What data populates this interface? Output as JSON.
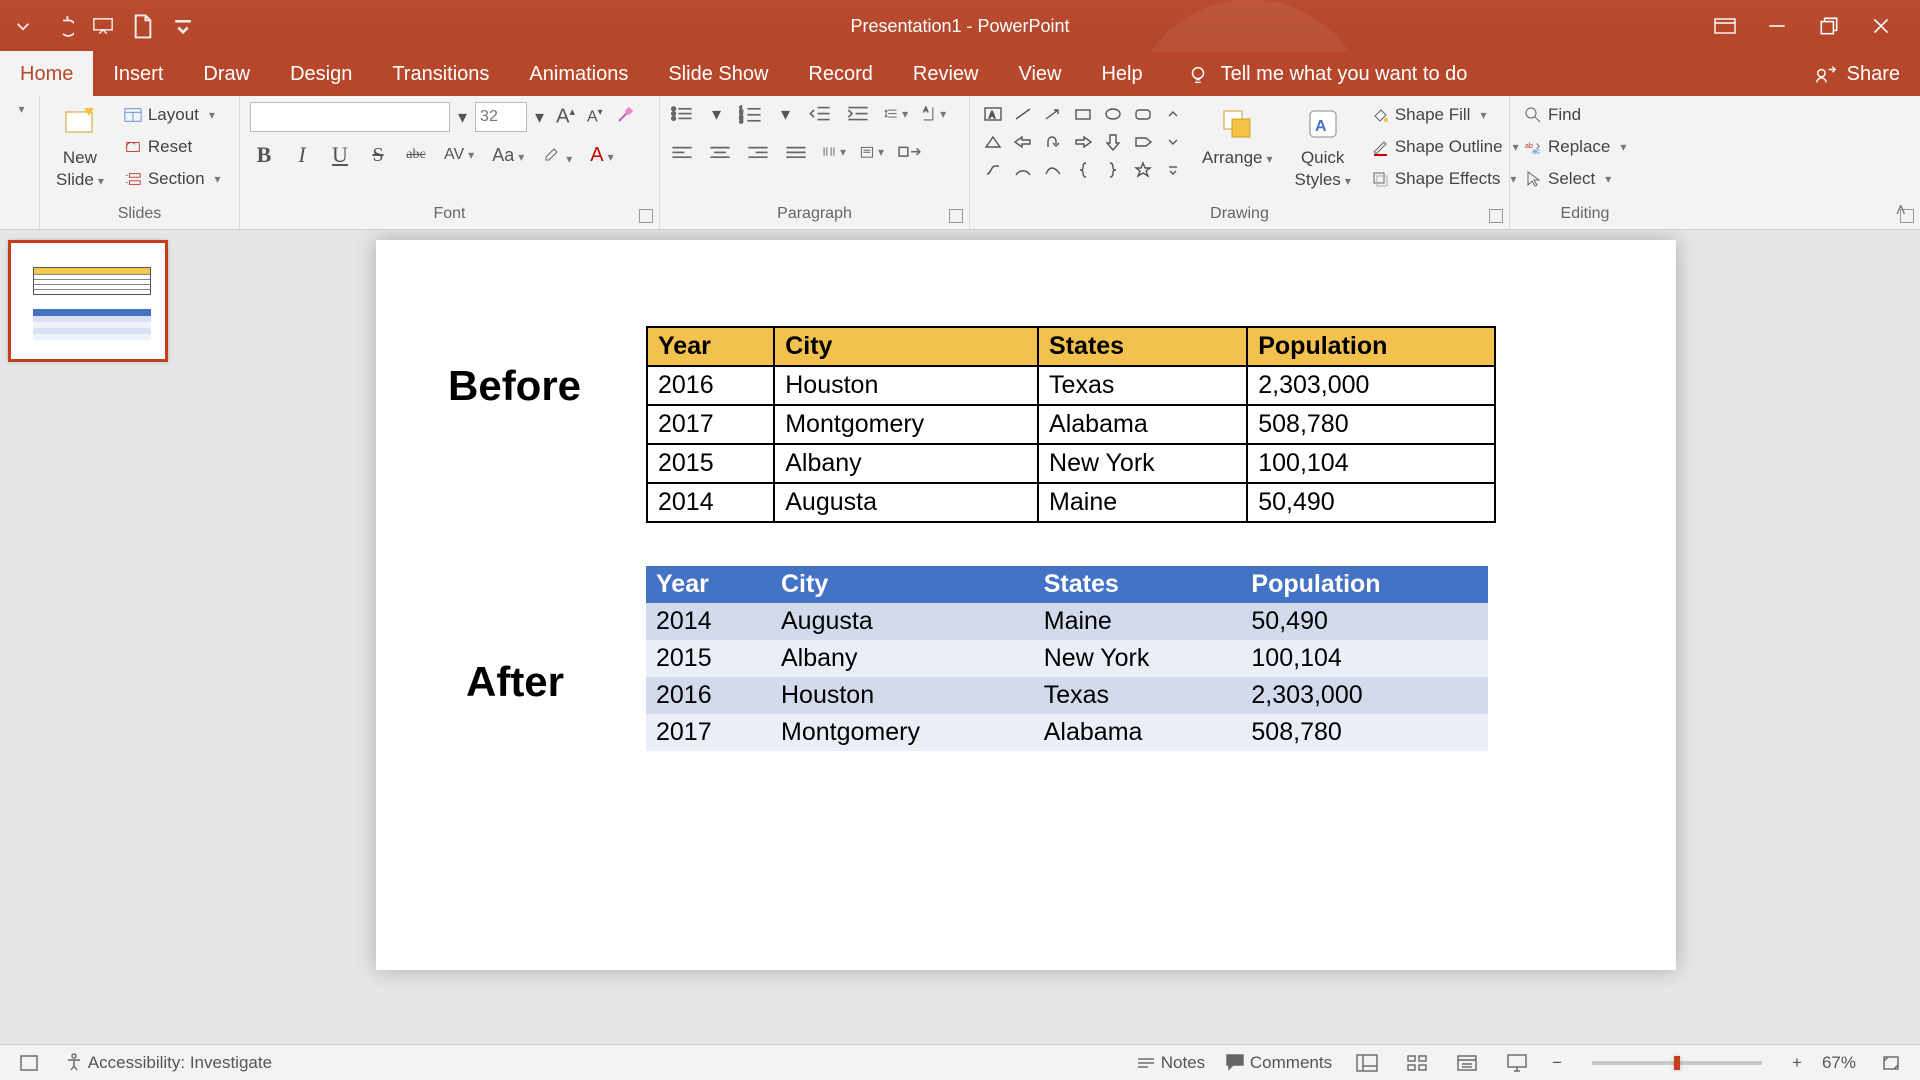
{
  "title": "Presentation1  -  PowerPoint",
  "qat": {
    "undo": "undo",
    "redo": "redo",
    "start": "start",
    "new": "new"
  },
  "window": {
    "ribbonopts": "ribbon-display-options",
    "min": "minimize",
    "max": "restore",
    "close": "close"
  },
  "tabs": [
    "Home",
    "Insert",
    "Draw",
    "Design",
    "Transitions",
    "Animations",
    "Slide Show",
    "Record",
    "Review",
    "View",
    "Help"
  ],
  "active_tab": "Home",
  "tellme": "Tell me what you want to do",
  "share": "Share",
  "ribbon": {
    "slides": {
      "label": "Slides",
      "new_slide_top": "New",
      "new_slide_bottom": "Slide",
      "layout": "Layout",
      "reset": "Reset",
      "section": "Section"
    },
    "font": {
      "label": "Font",
      "size_placeholder": "32"
    },
    "paragraph": {
      "label": "Paragraph"
    },
    "drawing": {
      "label": "Drawing",
      "arrange": "Arrange",
      "quick_top": "Quick",
      "quick_bottom": "Styles",
      "shape_fill": "Shape Fill",
      "shape_outline": "Shape Outline",
      "shape_effects": "Shape Effects"
    },
    "editing": {
      "label": "Editing",
      "find": "Find",
      "replace": "Replace",
      "select": "Select"
    }
  },
  "slide": {
    "before_label": "Before",
    "after_label": "After",
    "headers": [
      "Year",
      "City",
      "States",
      "Population"
    ],
    "before_rows": [
      [
        "2016",
        "Houston",
        "Texas",
        "2,303,000"
      ],
      [
        "2017",
        "Montgomery",
        "Alabama",
        "508,780"
      ],
      [
        "2015",
        "Albany",
        "New York",
        "100,104"
      ],
      [
        "2014",
        "Augusta",
        "Maine",
        "50,490"
      ]
    ],
    "after_rows": [
      [
        "2014",
        "Augusta",
        "Maine",
        "50,490"
      ],
      [
        "2015",
        "Albany",
        "New York",
        "100,104"
      ],
      [
        "2016",
        "Houston",
        "Texas",
        "2,303,000"
      ],
      [
        "2017",
        "Montgomery",
        "Alabama",
        "508,780"
      ]
    ]
  },
  "status": {
    "accessibility": "Accessibility: Investigate",
    "notes": "Notes",
    "comments": "Comments",
    "zoom_pct": "67%"
  }
}
